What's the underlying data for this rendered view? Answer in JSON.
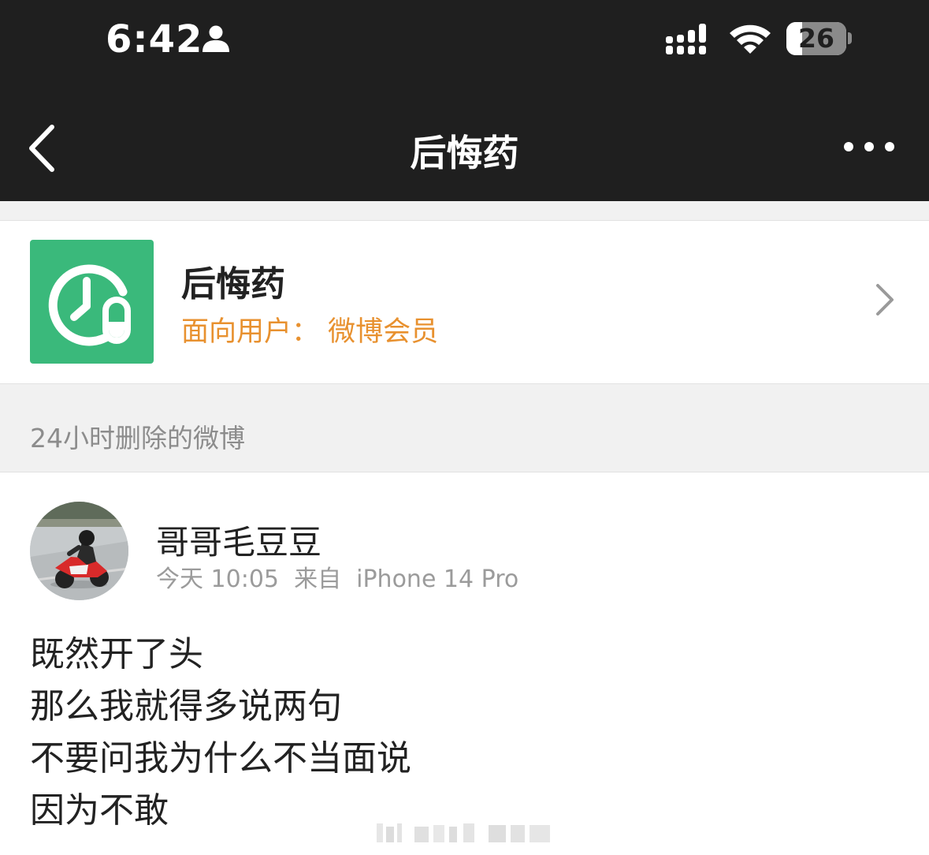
{
  "status_bar": {
    "time": "6:42",
    "battery_level": "26",
    "battery_fraction": 0.26,
    "icons": [
      "person-icon",
      "signal-icon",
      "wifi-icon",
      "battery-icon"
    ]
  },
  "nav": {
    "title": "后悔药",
    "back_icon": "chevron-left-icon",
    "more_icon": "more-icon"
  },
  "feature": {
    "name": "后悔药",
    "audience": "面向用户： 微博会员",
    "logo_color": "#3ab97b",
    "chevron_icon": "chevron-right-icon"
  },
  "section": {
    "title": "24小时删除的微博"
  },
  "post": {
    "username": "哥哥毛豆豆",
    "meta": "今天 10:05  来自  iPhone 14 Pro",
    "lines": [
      "既然开了头",
      "那么我就得多说两句",
      "不要问我为什么不当面说",
      "因为不敢"
    ]
  },
  "colors": {
    "nav_bg": "#1f1f1f",
    "accent_orange": "#e8912f",
    "section_bg": "#f1f1f1"
  }
}
